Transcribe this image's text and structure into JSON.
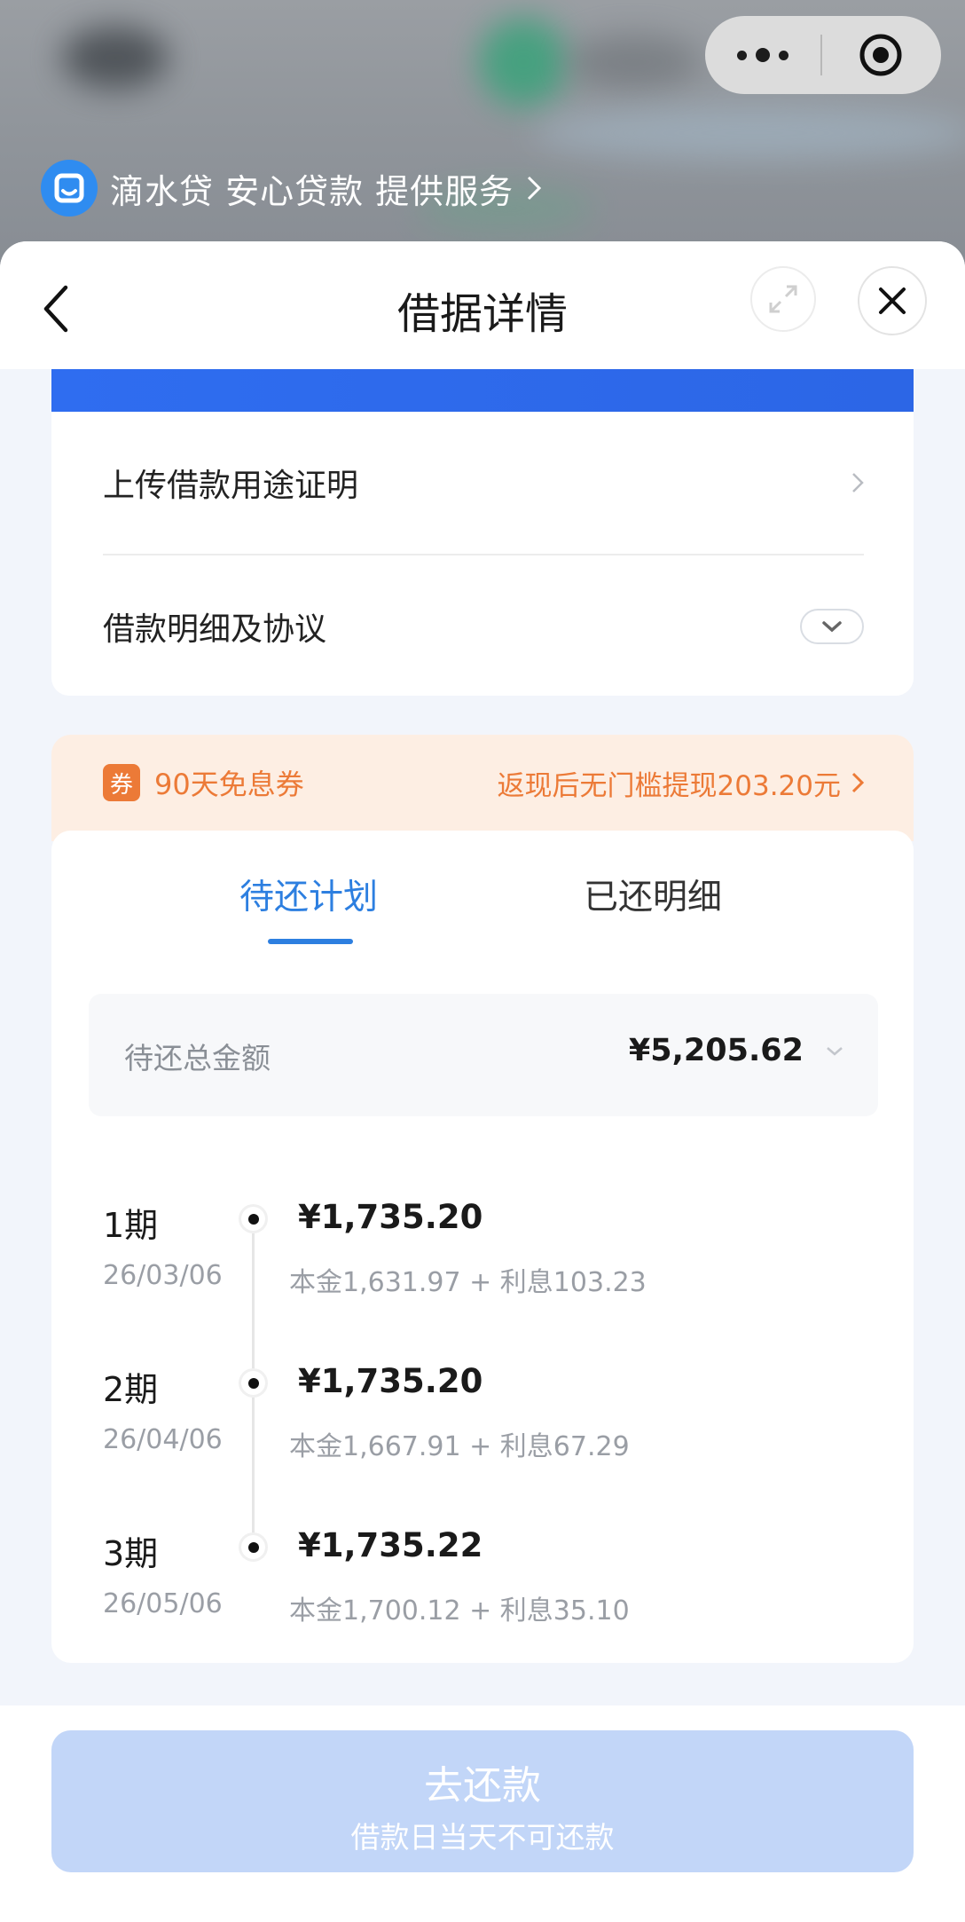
{
  "header": {
    "provider_text": "滴水贷 安心贷款 提供服务",
    "nav_title": "借据详情"
  },
  "menu": {
    "upload_label": "上传借款用途证明",
    "details_label": "借款明细及协议"
  },
  "coupon": {
    "badge": "券",
    "name": "90天免息券",
    "link": "返现后无门槛提现203.20元"
  },
  "tabs": {
    "plan": "待还计划",
    "history": "已还明细",
    "active": "plan"
  },
  "total": {
    "label": "待还总金额",
    "amount": "¥5,205.62"
  },
  "installments": [
    {
      "period": "1期",
      "date": "26/03/06",
      "amount": "¥1,735.20",
      "breakdown": "本金1,631.97 + 利息103.23"
    },
    {
      "period": "2期",
      "date": "26/04/06",
      "amount": "¥1,735.20",
      "breakdown": "本金1,667.91 + 利息67.29"
    },
    {
      "period": "3期",
      "date": "26/05/06",
      "amount": "¥1,735.22",
      "breakdown": "本金1,700.12 + 利息35.10"
    }
  ],
  "footer": {
    "button_label": "去还款",
    "button_sub": "借款日当天不可还款"
  },
  "colors": {
    "accent_blue": "#2d7fe0",
    "coupon_orange": "#ec7a37",
    "button_disabled": "#c2d6f8"
  },
  "icons": {
    "capsule_menu": "more-dots-icon",
    "capsule_close": "target-close-icon",
    "provider": "dishui-logo-icon",
    "back": "chevron-left-icon",
    "expand": "expand-icon",
    "close": "close-icon"
  }
}
